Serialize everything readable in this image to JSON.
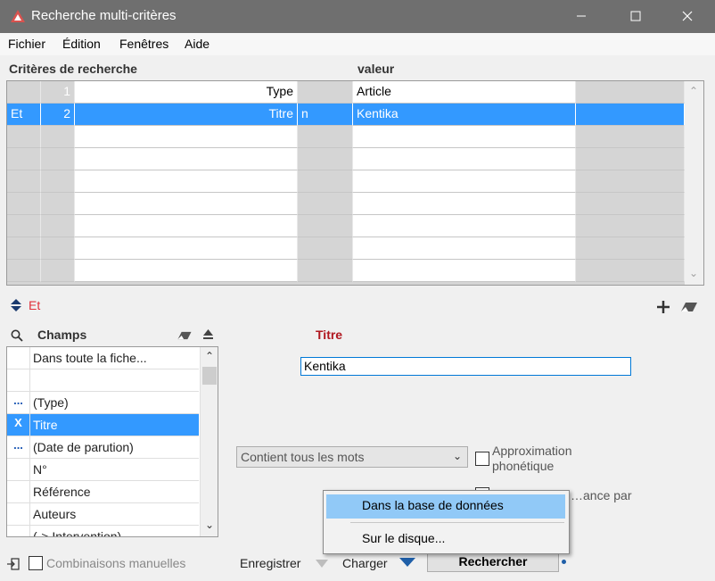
{
  "window": {
    "title": "Recherche multi-critères",
    "accent_color": "#6f6f6f",
    "minimize_icon": "minimize-icon",
    "maximize_icon": "maximize-icon",
    "close_icon": "close-icon"
  },
  "menu": [
    "Fichier",
    "Édition",
    "Fenêtres",
    "Aide"
  ],
  "criteria": {
    "header_label": "Critères de recherche",
    "value_header": "valeur",
    "rows": [
      {
        "op": "",
        "num": "1",
        "field": "Type",
        "neg": "",
        "value": "Article",
        "selected": false
      },
      {
        "op": "Et",
        "num": "2",
        "field": "Titre",
        "neg": "n",
        "value": "Kentika",
        "selected": true
      }
    ],
    "selection_color": "#3399ff"
  },
  "operator": {
    "label": "Et",
    "color": "#e0303a"
  },
  "fields": {
    "header": "Champs",
    "items": [
      {
        "mark": "",
        "label": "Dans toute la fiche...",
        "selected": false
      },
      {
        "mark": "",
        "label": "",
        "selected": false
      },
      {
        "mark": "...",
        "label": "(Type)",
        "selected": false
      },
      {
        "mark": "X",
        "label": "Titre",
        "selected": true
      },
      {
        "mark": "...",
        "label": "(Date de parution)",
        "selected": false
      },
      {
        "mark": "",
        "label": "N°",
        "selected": false
      },
      {
        "mark": "",
        "label": "Référence",
        "selected": false
      },
      {
        "mark": "",
        "label": "Auteurs",
        "selected": false
      },
      {
        "mark": "",
        "label": "(-> Intervention)",
        "selected": false
      }
    ]
  },
  "detail": {
    "field_title": "Titre",
    "field_title_color": "#b0171f",
    "input_value": "Kentika",
    "match_mode": "Contient tous les mots",
    "phonetic_label": "Approximation phonétique",
    "relevance_label": "…ance par"
  },
  "popup": {
    "options": [
      "Dans la base de données",
      "Sur le disque..."
    ]
  },
  "bottom": {
    "manual_label": "Combinaisons manuelles",
    "save_label": "Enregistrer",
    "load_label": "Charger",
    "search_label": "Rechercher"
  }
}
